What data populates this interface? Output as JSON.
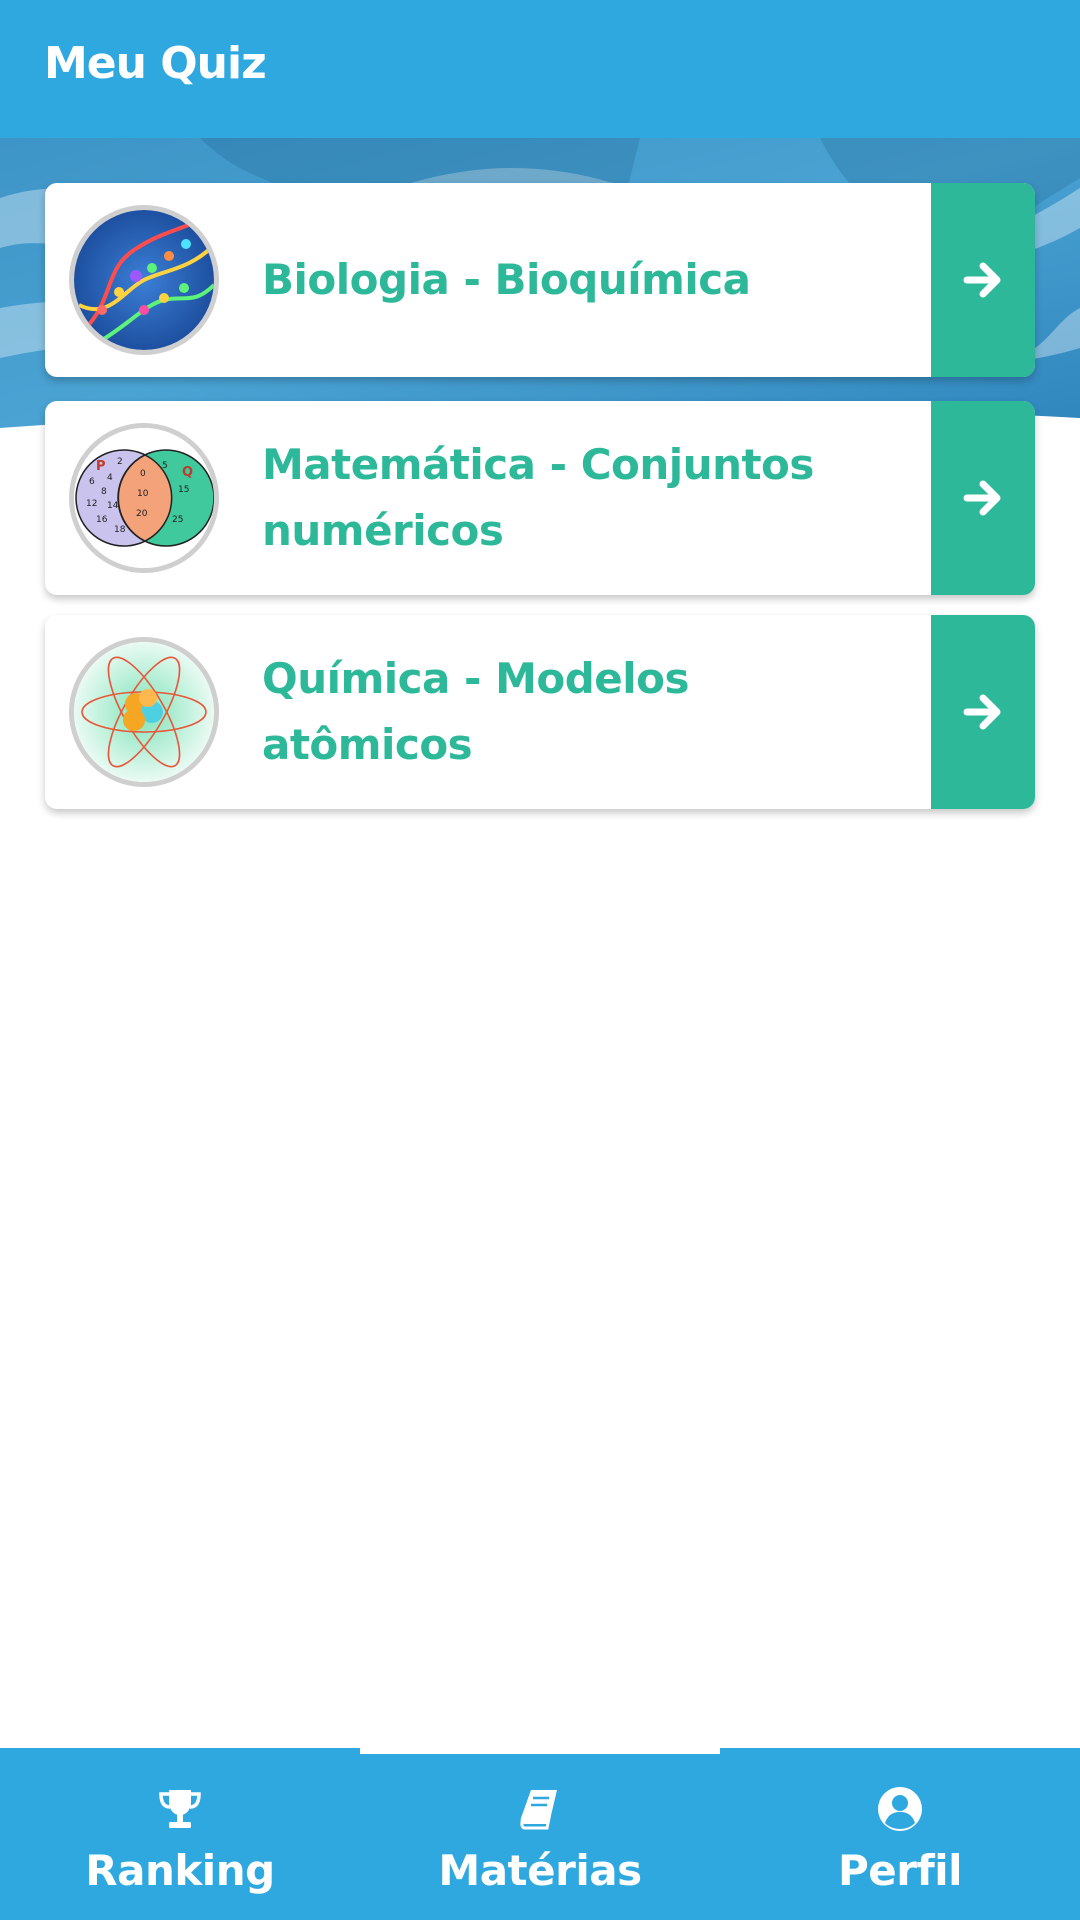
{
  "app": {
    "title": "Meu Quiz"
  },
  "subjects": [
    {
      "title": "Biologia - Bioquímica",
      "thumb_icon": "dna-image",
      "arrow_icon": "arrow-right-icon"
    },
    {
      "title": "Matemática - Conjuntos numéricos",
      "thumb_icon": "venn-diagram-image",
      "arrow_icon": "arrow-right-icon",
      "venn": {
        "set_p_label": "P",
        "set_q_label": "Q",
        "p_only": [
          "2",
          "4",
          "6",
          "8",
          "12",
          "14",
          "16",
          "18"
        ],
        "intersection": [
          "0",
          "10",
          "20"
        ],
        "q_only": [
          "5",
          "15",
          "25"
        ]
      }
    },
    {
      "title": "Química - Modelos atômicos",
      "thumb_icon": "atom-image",
      "arrow_icon": "arrow-right-icon"
    }
  ],
  "bottom_nav": {
    "items": [
      {
        "label": "Ranking",
        "icon": "trophy-icon"
      },
      {
        "label": "Matérias",
        "icon": "book-icon",
        "active": true
      },
      {
        "label": "Perfil",
        "icon": "user-circle-icon"
      }
    ]
  },
  "colors": {
    "primary": "#2fa8e0",
    "accent": "#2cb899",
    "card_bg": "#ffffff"
  }
}
